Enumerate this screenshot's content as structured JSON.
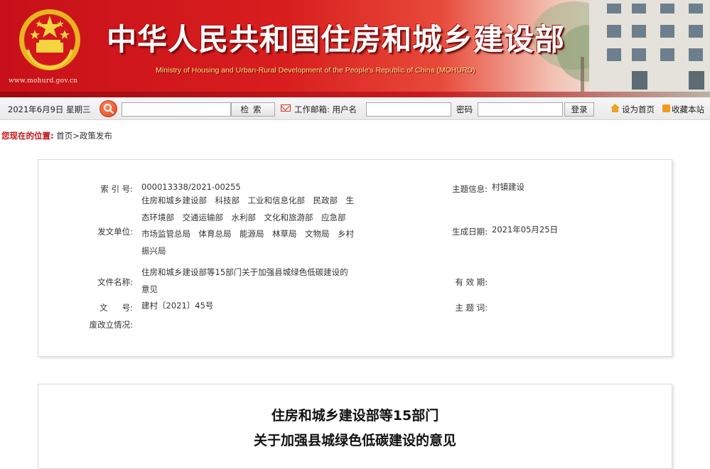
{
  "banner": {
    "site_url": "www.mohurd.gov.cn",
    "title": "中华人民共和国住房和城乡建设部",
    "subtitle": "Ministry of Housing and Urban-Rural Development of the People's Republic of China (MOHURD)",
    "emblem": "national-emblem"
  },
  "toolbar": {
    "date": "2021年6月9日 星期三",
    "search_placeholder": "",
    "search_button": "检索",
    "mail_label": "工作邮箱: 用户名",
    "username_value": "",
    "password_label": "密码",
    "password_value": "",
    "login_button": "登录",
    "set_home": "设为首页",
    "bookmark": "收藏本站"
  },
  "breadcrumb": {
    "location_label": "您现在的位置:",
    "path": "首页>政策发布"
  },
  "info": {
    "index_label": "索 引 号:",
    "index_value": "000013338/2021-00255",
    "subject_label": "主题信息:",
    "subject_value": "村镇建设",
    "units_label": "发文单位:",
    "units_value": "住房和城乡建设部　科技部　工业和信息化部　民政部　生态环境部　交通运输部　水利部　文化和旅游部　应急部　市场监管总局　体育总局　能源局　林草局　文物局　乡村振兴局",
    "date_label": "生成日期:",
    "date_value": "2021年05月25日",
    "filename_label": "文件名称:",
    "filename_value": "住房和城乡建设部等15部门关于加强县城绿色低碳建设的意见",
    "validity_label": "有 效 期:",
    "validity_value": "",
    "docno_label_1": "文",
    "docno_label_2": "号:",
    "docno_value": "建村〔2021〕45号",
    "keywords_label": "主 题 词:",
    "keywords_value": "",
    "status_label": "废改立情况:",
    "status_value": ""
  },
  "article": {
    "title_line1": "住房和城乡建设部等15部门",
    "title_line2": "关于加强县城绿色低碳建设的意见"
  },
  "colors": {
    "brand_red": "#c8101a",
    "location_red": "#c51212"
  }
}
